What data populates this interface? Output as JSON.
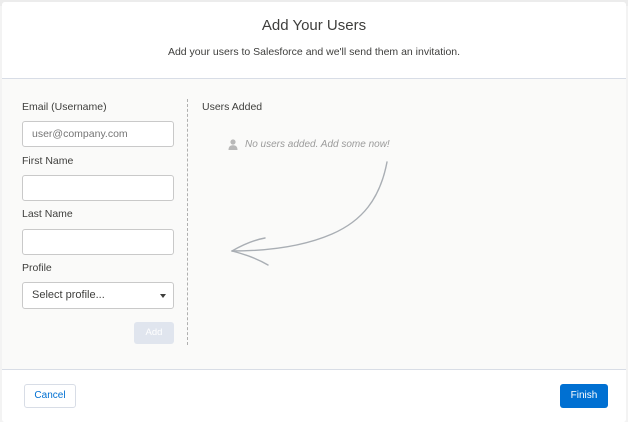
{
  "header": {
    "title": "Add Your Users",
    "subtitle": "Add your users to Salesforce and we'll send them an invitation."
  },
  "form": {
    "email": {
      "label": "Email (Username)",
      "placeholder": "user@company.com",
      "value": ""
    },
    "first_name": {
      "label": "First Name",
      "placeholder": "",
      "value": ""
    },
    "last_name": {
      "label": "Last Name",
      "placeholder": "",
      "value": ""
    },
    "profile": {
      "label": "Profile",
      "selected": "Select profile..."
    },
    "add_label": "Add"
  },
  "users_added": {
    "label": "Users Added",
    "empty_message": "No users added. Add some now!"
  },
  "footer": {
    "cancel_label": "Cancel",
    "finish_label": "Finish"
  },
  "icons": {
    "person": "person-icon",
    "caret": "chevron-down-icon",
    "arrow": "curved-arrow-icon"
  },
  "colors": {
    "brand_blue": "#0070d2",
    "disabled_button": "#e0e5ee",
    "muted_text": "#9b9b9b"
  }
}
